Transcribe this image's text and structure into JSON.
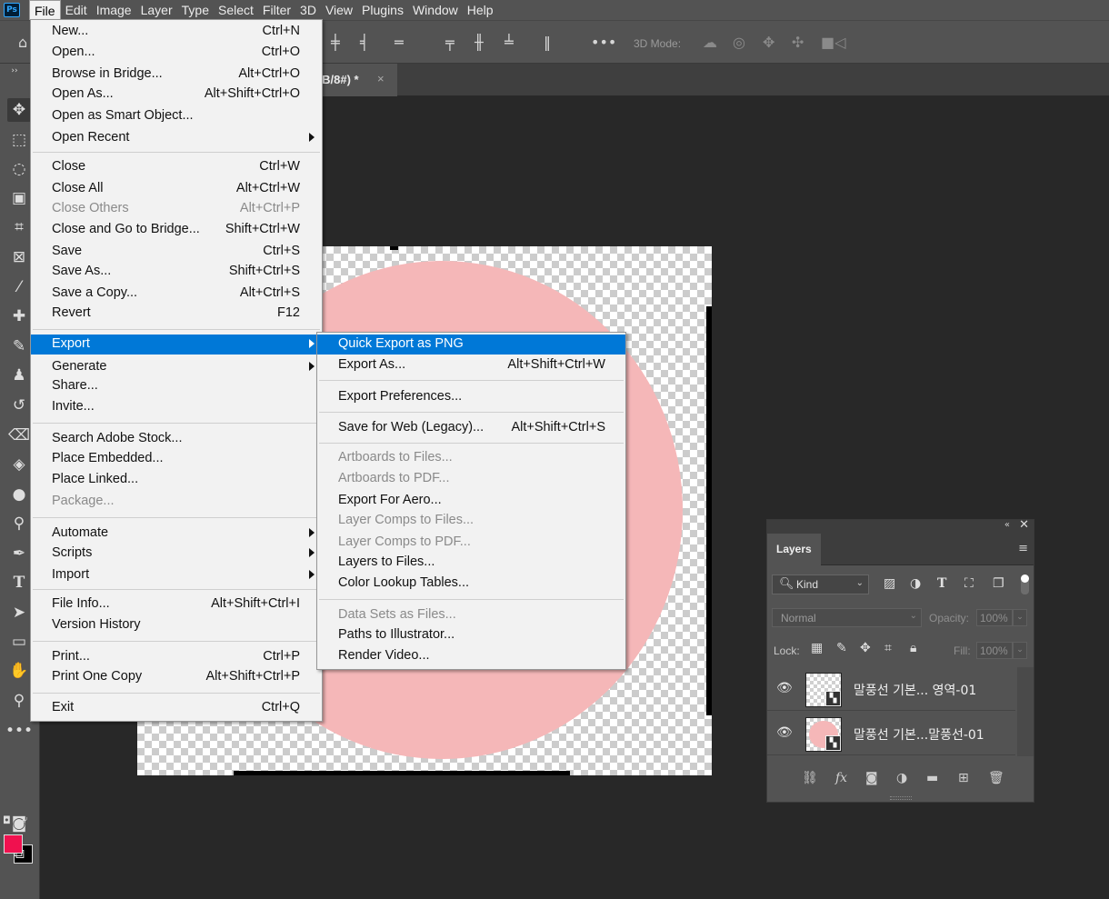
{
  "app": {
    "logo": "Ps"
  },
  "menubar": {
    "items": [
      "File",
      "Edit",
      "Image",
      "Layer",
      "Type",
      "Select",
      "Filter",
      "3D",
      "View",
      "Plugins",
      "Window",
      "Help"
    ]
  },
  "options_bar": {
    "three_d_label": "3D Mode:",
    "more_icon": "ellipsis-icon"
  },
  "document_tab": {
    "title_fragment": "GB/8#) *",
    "close_glyph": "×"
  },
  "file_menu": {
    "items": [
      {
        "label": "New...",
        "shortcut": "Ctrl+N"
      },
      {
        "label": "Open...",
        "shortcut": "Ctrl+O"
      },
      {
        "label": "Browse in Bridge...",
        "shortcut": "Alt+Ctrl+O"
      },
      {
        "label": "Open As...",
        "shortcut": "Alt+Shift+Ctrl+O"
      },
      {
        "label": "Open as Smart Object...",
        "shortcut": ""
      },
      {
        "label": "Open Recent",
        "shortcut": ""
      },
      {
        "label": "Close",
        "shortcut": "Ctrl+W"
      },
      {
        "label": "Close All",
        "shortcut": "Alt+Ctrl+W"
      },
      {
        "label": "Close Others",
        "shortcut": "Alt+Ctrl+P"
      },
      {
        "label": "Close and Go to Bridge...",
        "shortcut": "Shift+Ctrl+W"
      },
      {
        "label": "Save",
        "shortcut": "Ctrl+S"
      },
      {
        "label": "Save As...",
        "shortcut": "Shift+Ctrl+S"
      },
      {
        "label": "Save a Copy...",
        "shortcut": "Alt+Ctrl+S"
      },
      {
        "label": "Revert",
        "shortcut": "F12"
      },
      {
        "label": "Export",
        "shortcut": ""
      },
      {
        "label": "Generate",
        "shortcut": ""
      },
      {
        "label": "Share...",
        "shortcut": ""
      },
      {
        "label": "Invite...",
        "shortcut": ""
      },
      {
        "label": "Search Adobe Stock...",
        "shortcut": ""
      },
      {
        "label": "Place Embedded...",
        "shortcut": ""
      },
      {
        "label": "Place Linked...",
        "shortcut": ""
      },
      {
        "label": "Package...",
        "shortcut": ""
      },
      {
        "label": "Automate",
        "shortcut": ""
      },
      {
        "label": "Scripts",
        "shortcut": ""
      },
      {
        "label": "Import",
        "shortcut": ""
      },
      {
        "label": "File Info...",
        "shortcut": "Alt+Shift+Ctrl+I"
      },
      {
        "label": "Version History",
        "shortcut": ""
      },
      {
        "label": "Print...",
        "shortcut": "Ctrl+P"
      },
      {
        "label": "Print One Copy",
        "shortcut": "Alt+Shift+Ctrl+P"
      },
      {
        "label": "Exit",
        "shortcut": "Ctrl+Q"
      }
    ]
  },
  "export_menu": {
    "items": [
      {
        "label": "Quick Export as PNG",
        "shortcut": ""
      },
      {
        "label": "Export As...",
        "shortcut": "Alt+Shift+Ctrl+W"
      },
      {
        "label": "Export Preferences...",
        "shortcut": ""
      },
      {
        "label": "Save for Web (Legacy)...",
        "shortcut": "Alt+Shift+Ctrl+S"
      },
      {
        "label": "Artboards to Files...",
        "shortcut": ""
      },
      {
        "label": "Artboards to PDF...",
        "shortcut": ""
      },
      {
        "label": "Export For Aero...",
        "shortcut": ""
      },
      {
        "label": "Layer Comps to Files...",
        "shortcut": ""
      },
      {
        "label": "Layer Comps to PDF...",
        "shortcut": ""
      },
      {
        "label": "Layers to Files...",
        "shortcut": ""
      },
      {
        "label": "Color Lookup Tables...",
        "shortcut": ""
      },
      {
        "label": "Data Sets as Files...",
        "shortcut": ""
      },
      {
        "label": "Paths to Illustrator...",
        "shortcut": ""
      },
      {
        "label": "Render Video...",
        "shortcut": ""
      }
    ]
  },
  "colors": {
    "foreground": "#f0114f",
    "background": "#000000",
    "canvas_shape": "#f5b7b8",
    "menu_highlight": "#0078d7"
  },
  "layers_panel": {
    "tab_label": "Layers",
    "filter_kind": "Kind",
    "blend_mode": "Normal",
    "opacity_label": "Opacity:",
    "opacity_value": "100%",
    "lock_label": "Lock:",
    "fill_label": "Fill:",
    "fill_value": "100%",
    "layers": [
      {
        "name": "말풍선 기본... 영역-01",
        "visible": true
      },
      {
        "name": "말풍선 기본...말풍선-01",
        "visible": true
      }
    ]
  }
}
